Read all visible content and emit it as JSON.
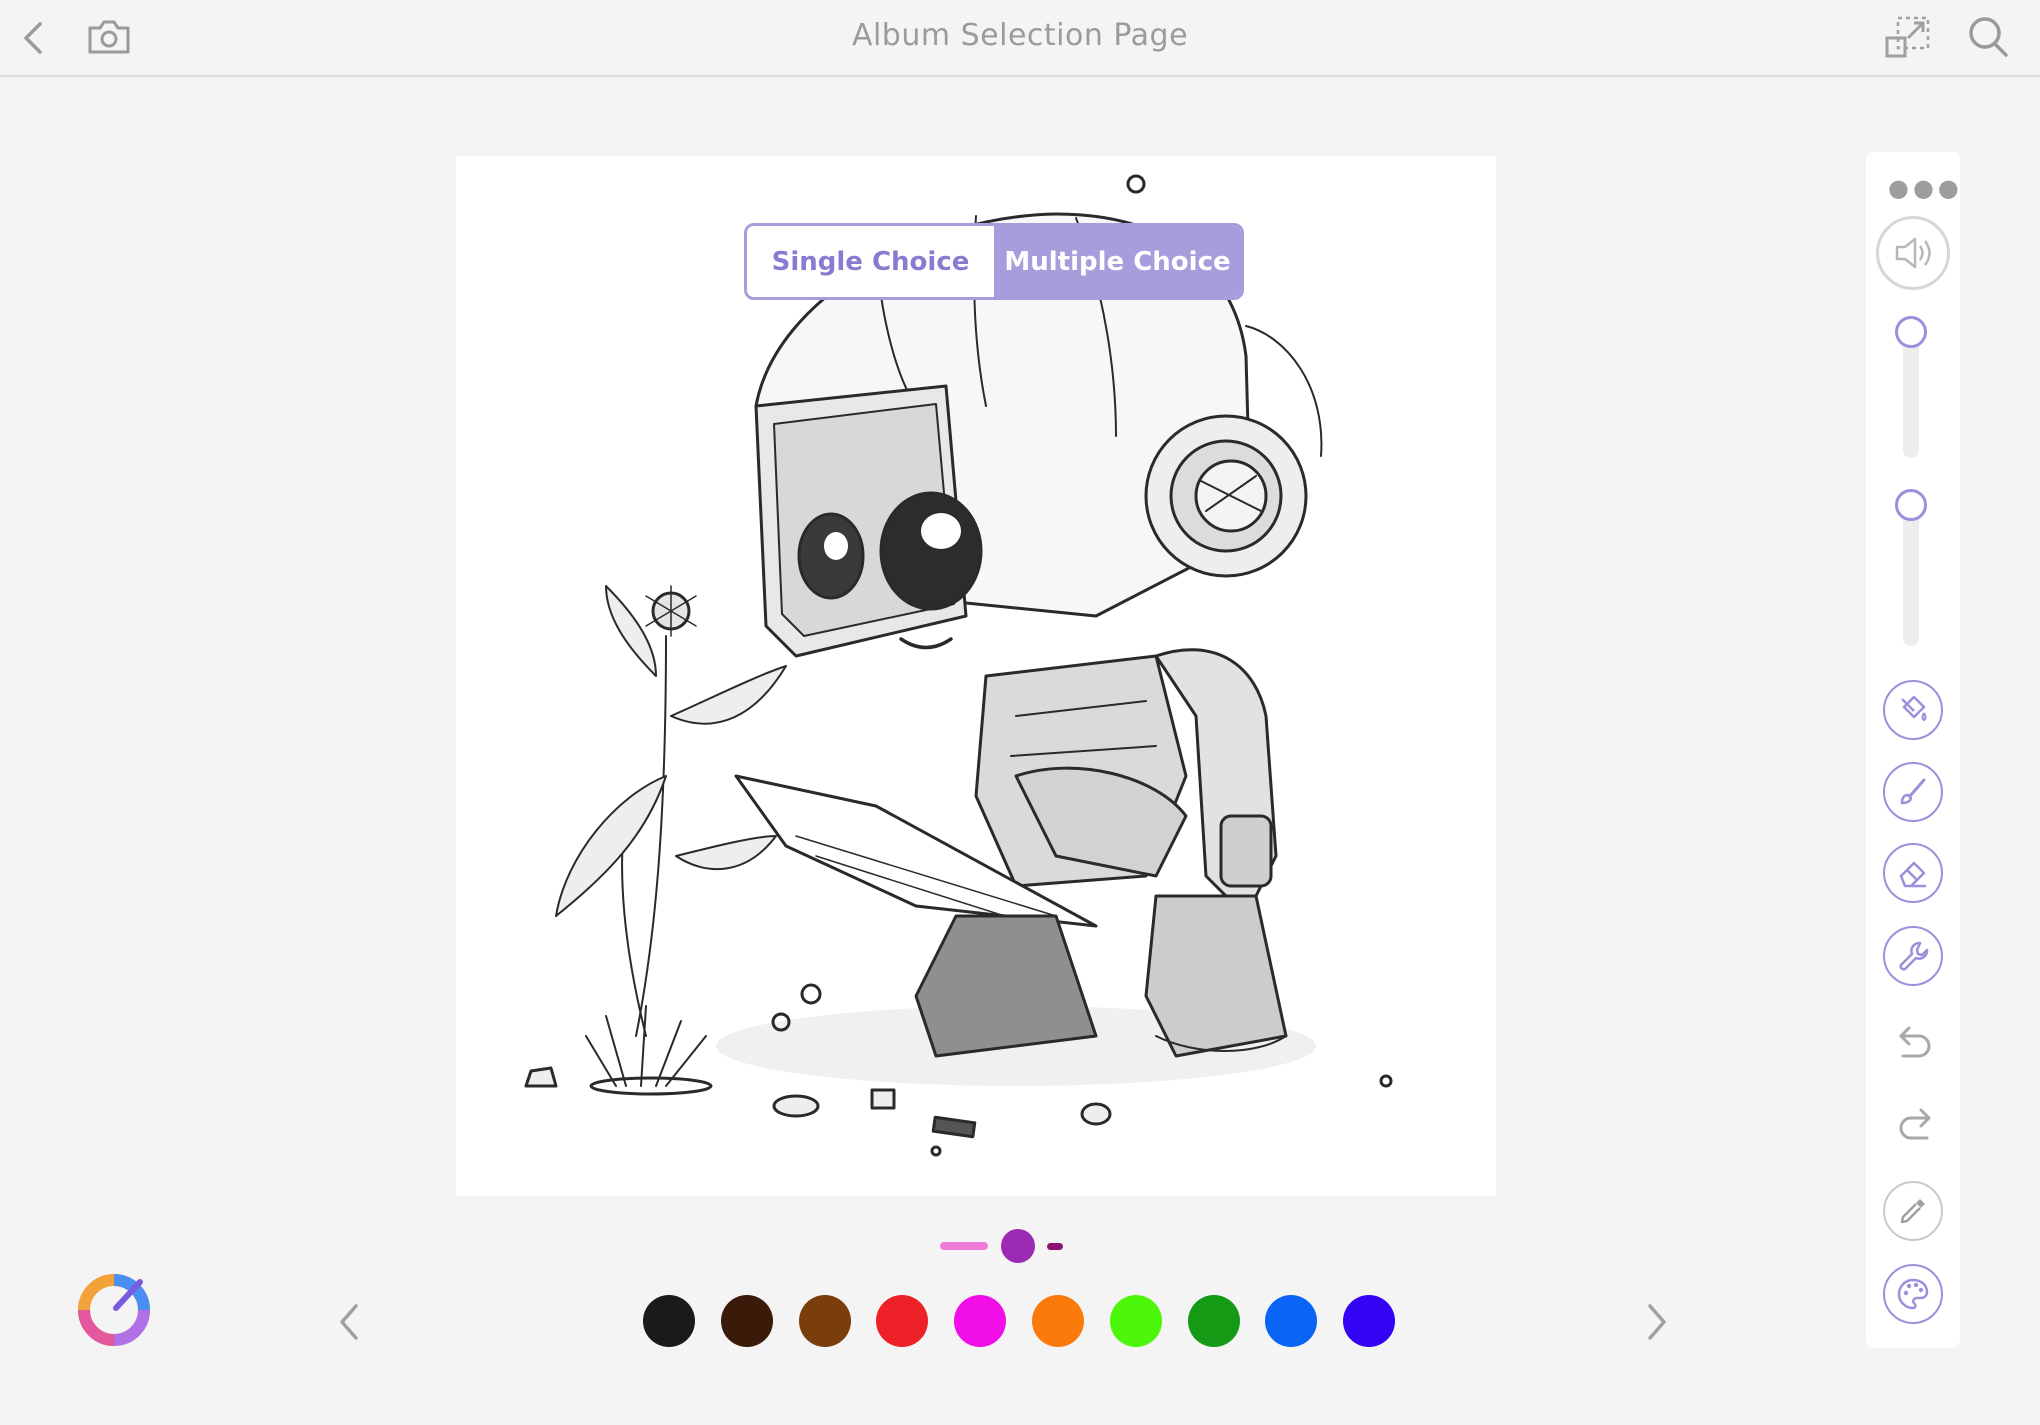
{
  "header": {
    "title": "Album Selection Page",
    "icons": [
      "back-chevron-icon",
      "camera-icon",
      "fullscreen-icon",
      "search-icon"
    ]
  },
  "mode_toggle": {
    "single_label": "Single Choice",
    "multiple_label": "Multiple Choice",
    "selected": "Multiple Choice"
  },
  "side_toolbar": {
    "items": [
      "more-icon",
      "volume-icon",
      "fill-bucket-icon",
      "brush-icon",
      "eraser-icon",
      "wrench-icon",
      "undo-icon",
      "redo-icon",
      "eyedropper-icon",
      "palette-icon"
    ],
    "slider_1_level": 0.1,
    "slider_2_level": 0.1
  },
  "palette": {
    "colors": [
      "#1a1a1a",
      "#3a1a08",
      "#7a3e0c",
      "#ee2028",
      "#f20ee8",
      "#fb7a0c",
      "#4cf70c",
      "#149a14",
      "#0a64f5",
      "#3204f3"
    ],
    "brush_size_colors": [
      "#ef7cd6",
      "#9c2ab4",
      "#8c1470"
    ]
  },
  "colors": {
    "accent": "#a89ddc",
    "accent_text": "#8a7ad0"
  }
}
